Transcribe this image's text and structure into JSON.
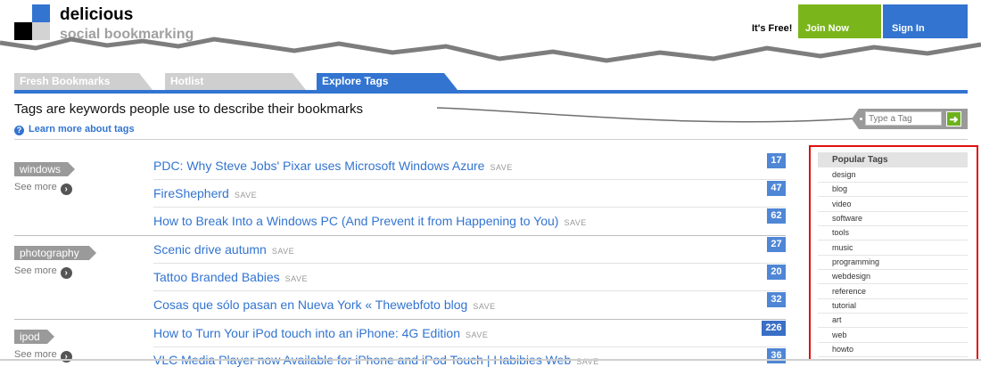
{
  "header": {
    "brand_name": "delicious",
    "brand_tagline": "social bookmarking",
    "its_free": "It's Free!",
    "join_label": "Join Now",
    "signin_label": "Sign In"
  },
  "tabs": [
    {
      "label": "Fresh Bookmarks",
      "active": false
    },
    {
      "label": "Hotlist",
      "active": false
    },
    {
      "label": "Explore Tags",
      "active": true
    }
  ],
  "intro": {
    "text": "Tags are keywords people use to describe their bookmarks",
    "learn_more": "Learn more about tags"
  },
  "tag_search": {
    "placeholder": "Type a Tag",
    "go": "➜"
  },
  "tag_groups": [
    {
      "tag": "windows",
      "see_more": "See more",
      "bookmarks": [
        {
          "title": "PDC: Why Steve Jobs' Pixar uses Microsoft Windows Azure",
          "save": "SAVE",
          "count": "17"
        },
        {
          "title": "FireShepherd",
          "save": "SAVE",
          "count": "47"
        },
        {
          "title": "How to Break Into a Windows PC (And Prevent it from Happening to You)",
          "save": "SAVE",
          "count": "62"
        }
      ]
    },
    {
      "tag": "photography",
      "see_more": "See more",
      "bookmarks": [
        {
          "title": "Scenic drive autumn",
          "save": "SAVE",
          "count": "27"
        },
        {
          "title": "Tattoo Branded Babies",
          "save": "SAVE",
          "count": "20"
        },
        {
          "title": "Cosas que sólo pasan en Nueva York « Thewebfoto blog",
          "save": "SAVE",
          "count": "32"
        }
      ]
    },
    {
      "tag": "ipod",
      "see_more": "See more",
      "bookmarks": [
        {
          "title": "How to Turn Your iPod touch into an iPhone: 4G Edition",
          "save": "SAVE",
          "count": "226"
        },
        {
          "title": "VLC Media Player now Available for iPhone and iPod Touch | Habibies Web",
          "save": "SAVE",
          "count": "36"
        }
      ]
    }
  ],
  "popular_tags": {
    "title": "Popular Tags",
    "items": [
      "design",
      "blog",
      "video",
      "software",
      "tools",
      "music",
      "programming",
      "webdesign",
      "reference",
      "tutorial",
      "art",
      "web",
      "howto"
    ]
  },
  "colors": {
    "brand_blue": "#3274d0",
    "join_green": "#7bb51c",
    "count_blue": "#4f86d6",
    "highlight_red": "#e01010"
  }
}
